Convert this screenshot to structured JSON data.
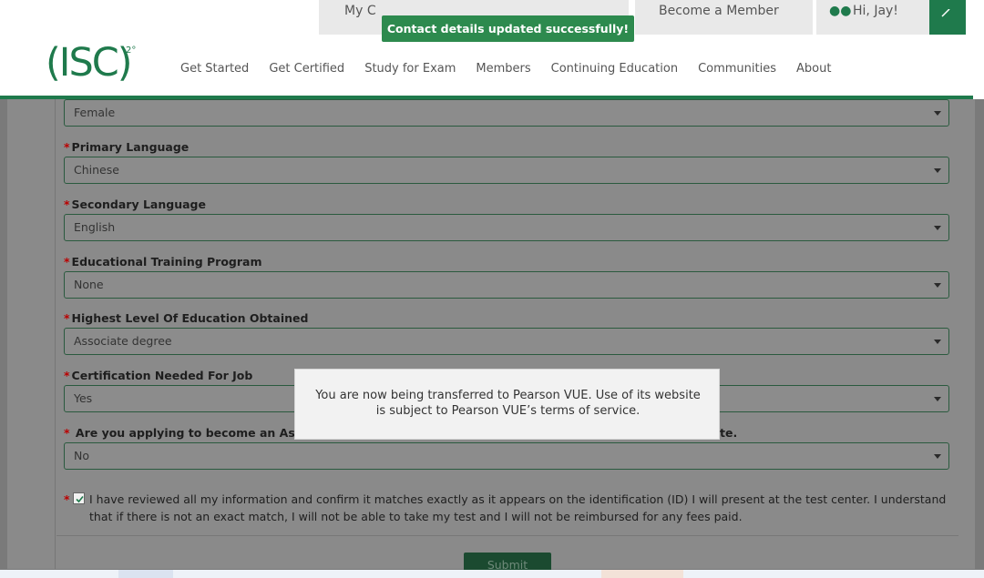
{
  "toast": {
    "message": "Contact details updated successfully!"
  },
  "utility_bar": {
    "item_1": "My C",
    "item_2": "Become a Member",
    "item_3": "Hi, Jay!"
  },
  "logo": {
    "text": "(ISC)",
    "superscript": "2°"
  },
  "nav": {
    "items": [
      {
        "label": "Get Started"
      },
      {
        "label": "Get Certified"
      },
      {
        "label": "Study for Exam"
      },
      {
        "label": "Members"
      },
      {
        "label": "Continuing Education"
      },
      {
        "label": "Communities"
      },
      {
        "label": "About"
      }
    ]
  },
  "form": {
    "gender": {
      "value": "Female"
    },
    "primary_language": {
      "label": "Primary Language",
      "value": "Chinese"
    },
    "secondary_language": {
      "label": "Secondary Language",
      "value": "English"
    },
    "educational_training_program": {
      "label": "Educational Training Program",
      "value": "None"
    },
    "highest_education": {
      "label": "Highest Level Of Education Obtained",
      "value": "Associate degree"
    },
    "certification_needed": {
      "label": "Certification Needed For Job",
      "value": "Yes"
    },
    "associate_applying": {
      "label_left": "Are you applying to become an Associat",
      "label_right": "te.",
      "value": "No"
    },
    "required_star": "*",
    "confirm_text": "I have reviewed all my information and confirm it matches exactly as it appears on the identification (ID) I will present at the test center. I understand that if there is not an exact match, I will not be able to take my test and I will not be reimbursed for any fees paid.",
    "confirm_checked": true,
    "submit_label": "Submit"
  },
  "modal": {
    "message": "You are now being transferred to Pearson VUE. Use of its website is subject to Pearson VUE’s terms of service."
  },
  "colors": {
    "brand_green": "#1f7a4c",
    "toast_green": "#2d8a4e",
    "required_red": "#bb0000"
  }
}
